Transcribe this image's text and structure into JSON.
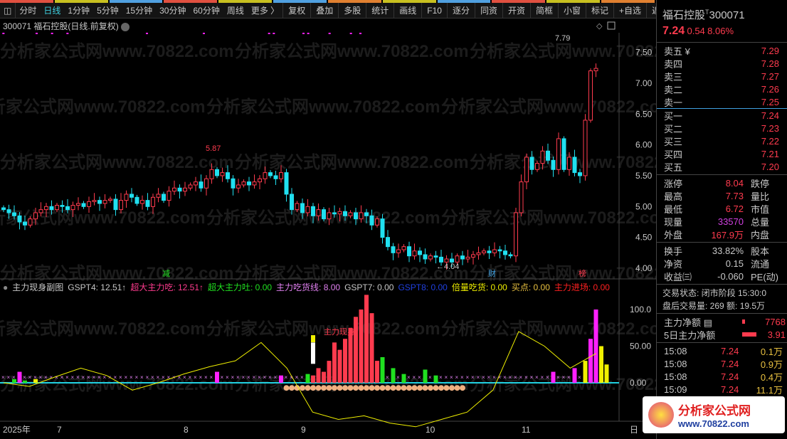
{
  "toolbar": {
    "periods": [
      "分时",
      "日线",
      "1分钟",
      "5分钟",
      "15分钟",
      "30分钟",
      "60分钟",
      "周线",
      "更多 〉"
    ],
    "active_period": "日线",
    "buttons": [
      "复权",
      "叠加",
      "多股",
      "统计",
      "画线",
      "F10",
      "逐分",
      "同资",
      "开资",
      "简框",
      "小窗",
      "标记",
      "+自选",
      "返回"
    ]
  },
  "stripe_colors": [
    "#e05040",
    "#c8c020",
    "#50a0e0",
    "#e05040",
    "#c8c020",
    "#50a0e0",
    "#e08030",
    "#c8c020",
    "#50a0e0",
    "#e05040",
    "#c8c020",
    "#e08030"
  ],
  "chart_title": "300071 福石控股(日线.前复权)",
  "watermark": "分析家公式网www.70822.com",
  "annotations": {
    "high_label": "5.87",
    "low_label": "←4.04",
    "peak_label": "7.79",
    "marker_jian": "减",
    "marker_cai": "财",
    "marker_bang": "榜",
    "zhuli_label": "主力现身"
  },
  "colors": {
    "up": "#ff3b4e",
    "down": "#20e0f0",
    "yellow_line": "#f0f000",
    "magenta": "#ff20ff",
    "green": "#20e020"
  },
  "chart_data": {
    "type": "candlestick",
    "price_axis": {
      "ticks": [
        "7.50",
        "7.00",
        "6.50",
        "6.00",
        "5.50",
        "5.00",
        "4.50",
        "4.00"
      ],
      "range": [
        3.9,
        7.85
      ]
    },
    "x_axis": {
      "labels": [
        "2025年",
        "7",
        "8",
        "9",
        "10",
        "11",
        "日"
      ]
    },
    "closes": [
      4.95,
      4.9,
      4.85,
      4.75,
      4.7,
      4.8,
      4.9,
      4.95,
      5.0,
      4.95,
      5.02,
      5.0,
      4.95,
      5.02,
      5.05,
      5.0,
      5.08,
      5.1,
      5.05,
      5.1,
      5.12,
      4.95,
      5.1,
      5.2,
      5.15,
      5.05,
      5.1,
      5.0,
      5.15,
      5.2,
      5.1,
      5.25,
      5.3,
      5.25,
      5.3,
      5.35,
      5.4,
      5.3,
      5.45,
      5.6,
      5.5,
      5.55,
      5.45,
      5.3,
      5.35,
      5.4,
      5.35,
      5.4,
      5.45,
      5.55,
      5.5,
      5.45,
      5.55,
      5.2,
      4.95,
      5.05,
      4.9,
      5.0,
      4.85,
      4.95,
      4.8,
      4.9,
      4.88,
      4.92,
      4.85,
      4.9,
      4.8,
      4.9,
      4.85,
      4.7,
      4.8,
      4.5,
      4.35,
      4.25,
      4.3,
      4.35,
      4.2,
      4.28,
      4.22,
      4.15,
      4.2,
      4.18,
      4.1,
      4.15,
      4.1,
      4.2,
      4.15,
      4.18,
      4.22,
      4.25,
      4.28,
      4.25,
      4.3,
      4.28,
      4.22,
      4.2,
      4.9,
      5.4,
      5.8,
      5.6,
      5.7,
      5.9,
      5.75,
      5.6,
      6.1,
      5.6,
      5.8,
      5.55,
      5.5,
      6.4,
      7.2,
      7.24
    ],
    "sub_axis": {
      "ticks": [
        "100.0",
        "50.00",
        "0.00"
      ],
      "range": [
        -60,
        110
      ]
    },
    "sub_red": {
      "58": 10,
      "59": 20,
      "60": 15,
      "61": 30,
      "62": 55,
      "63": 45,
      "64": 60,
      "65": 75,
      "66": 90,
      "67": 100,
      "68": 120,
      "69": 95,
      "70": 30
    },
    "sub_green": {
      "2": 5,
      "4": 3,
      "57": 12,
      "59": 8,
      "63": 25,
      "66": 12,
      "71": 35,
      "73": 20,
      "75": 12,
      "79": 18,
      "81": 10
    },
    "sub_magenta": {
      "3": 15,
      "40": 15,
      "52": 10,
      "103": 15,
      "107": 20,
      "110": 60,
      "111": 100
    },
    "sub_yellow": {
      "6": 5,
      "109": 30,
      "112": 50,
      "113": 25
    },
    "yellow_line": [
      0,
      -5,
      8,
      20,
      10,
      -10,
      0,
      12,
      22,
      30,
      55,
      20,
      -40,
      -50,
      -45,
      -55,
      -60,
      -50,
      -40,
      -10,
      70,
      50,
      20,
      40
    ]
  },
  "legend": [
    {
      "t": "主力现身副图",
      "c": "#c8c8c8"
    },
    {
      "t": "GSPT4: 12.51↑",
      "c": "#c8c8c8"
    },
    {
      "t": "超大主力吃: 12.51↑",
      "c": "#ff3b8e"
    },
    {
      "t": "超大主力吐: 0.00",
      "c": "#20e020"
    },
    {
      "t": "主力吃货线: 8.00",
      "c": "#e080f0"
    },
    {
      "t": "GSPT7: 0.00",
      "c": "#c8c8c8"
    },
    {
      "t": "GSPT8: 0.00",
      "c": "#2040e0"
    },
    {
      "t": "倍量吃货: 0.00",
      "c": "#f0f000"
    },
    {
      "t": "买点: 0.00",
      "c": "#e8c040"
    },
    {
      "t": "主力进场: 0.00",
      "c": "#ff2020"
    }
  ],
  "quote": {
    "name": "福石控股",
    "code": "300071",
    "price": "7.24",
    "change": "0.54",
    "pct": "8.06%",
    "sell": [
      {
        "l": "卖五 ¥",
        "v": "7.29"
      },
      {
        "l": "卖四",
        "v": "7.28"
      },
      {
        "l": "卖三",
        "v": "7.27"
      },
      {
        "l": "卖二",
        "v": "7.26"
      },
      {
        "l": "卖一",
        "v": "7.25"
      }
    ],
    "buy": [
      {
        "l": "买一",
        "v": "7.24"
      },
      {
        "l": "买二",
        "v": "7.23"
      },
      {
        "l": "买三",
        "v": "7.22"
      },
      {
        "l": "买四",
        "v": "7.21"
      },
      {
        "l": "买五",
        "v": "7.20"
      }
    ],
    "stats": [
      {
        "l": "涨停",
        "v": "8.04",
        "c": "red",
        "r": "跌停"
      },
      {
        "l": "最高",
        "v": "7.73",
        "c": "red",
        "r": "量比"
      },
      {
        "l": "最低",
        "v": "6.72",
        "c": "red",
        "r": "市值"
      },
      {
        "l": "现量",
        "v": "33570",
        "c": "mag",
        "r": "总量"
      },
      {
        "l": "外盘",
        "v": "167.9万",
        "c": "red",
        "r": "内盘"
      }
    ],
    "stats2": [
      {
        "l": "换手",
        "v": "33.82%",
        "r": "股本"
      },
      {
        "l": "净资",
        "v": "0.15",
        "r": "流通"
      },
      {
        "l": "收益㈢",
        "v": "-0.060",
        "r": "PE(动)"
      }
    ],
    "status": "交易状态: 闭市阶段 15:30:0",
    "after": "盘后交易量: 269  额: 19.5万",
    "flow": [
      {
        "l": "主力净额 ▤",
        "v": "7768"
      },
      {
        "l": "5日主力净额",
        "v": "3.91"
      }
    ],
    "ticks": [
      {
        "t": "15:08",
        "p": "7.24",
        "v": "0.1万"
      },
      {
        "t": "15:08",
        "p": "7.24",
        "v": "0.9万"
      },
      {
        "t": "15:08",
        "p": "7.24",
        "v": "0.4万"
      },
      {
        "t": "15:09",
        "p": "7.24",
        "v": "11.1万"
      }
    ],
    "logo": "分析家公式网",
    "logo_url": "www.70822.com"
  }
}
